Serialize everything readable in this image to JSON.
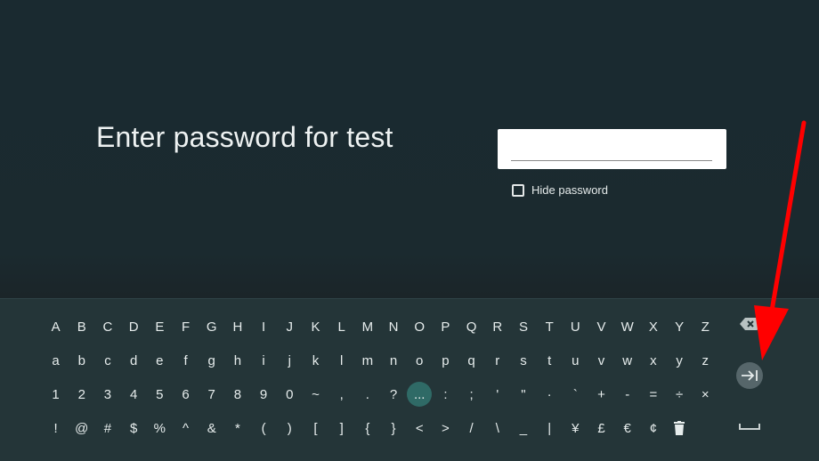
{
  "prompt": {
    "text": "Enter password for test"
  },
  "password_field": {
    "value": ""
  },
  "hide_password": {
    "label": "Hide password",
    "checked": false
  },
  "keyboard": {
    "rows": [
      [
        "A",
        "B",
        "C",
        "D",
        "E",
        "F",
        "G",
        "H",
        "I",
        "J",
        "K",
        "L",
        "M",
        "N",
        "O",
        "P",
        "Q",
        "R",
        "S",
        "T",
        "U",
        "V",
        "W",
        "X",
        "Y",
        "Z"
      ],
      [
        "a",
        "b",
        "c",
        "d",
        "e",
        "f",
        "g",
        "h",
        "i",
        "j",
        "k",
        "l",
        "m",
        "n",
        "o",
        "p",
        "q",
        "r",
        "s",
        "t",
        "u",
        "v",
        "w",
        "x",
        "y",
        "z"
      ],
      [
        "1",
        "2",
        "3",
        "4",
        "5",
        "6",
        "7",
        "8",
        "9",
        "0",
        "~",
        ",",
        ".",
        "?",
        "...",
        ":",
        ";",
        "'",
        "\"",
        "·",
        "`",
        "+",
        "-",
        "=",
        "÷",
        "×"
      ],
      [
        "!",
        "@",
        "#",
        "$",
        "%",
        "^",
        "&",
        "*",
        "(",
        ")",
        "[",
        "]",
        "{",
        "}",
        "<",
        ">",
        "/",
        "\\",
        "_",
        "|",
        "¥",
        "£",
        "€",
        "¢",
        "delete"
      ]
    ],
    "focused_key": "...",
    "side_keys": {
      "backspace": "backspace-icon",
      "next": "tab-next-icon",
      "space": "space-bar-icon"
    }
  },
  "annotation": {
    "arrow_color": "#ff0000"
  }
}
